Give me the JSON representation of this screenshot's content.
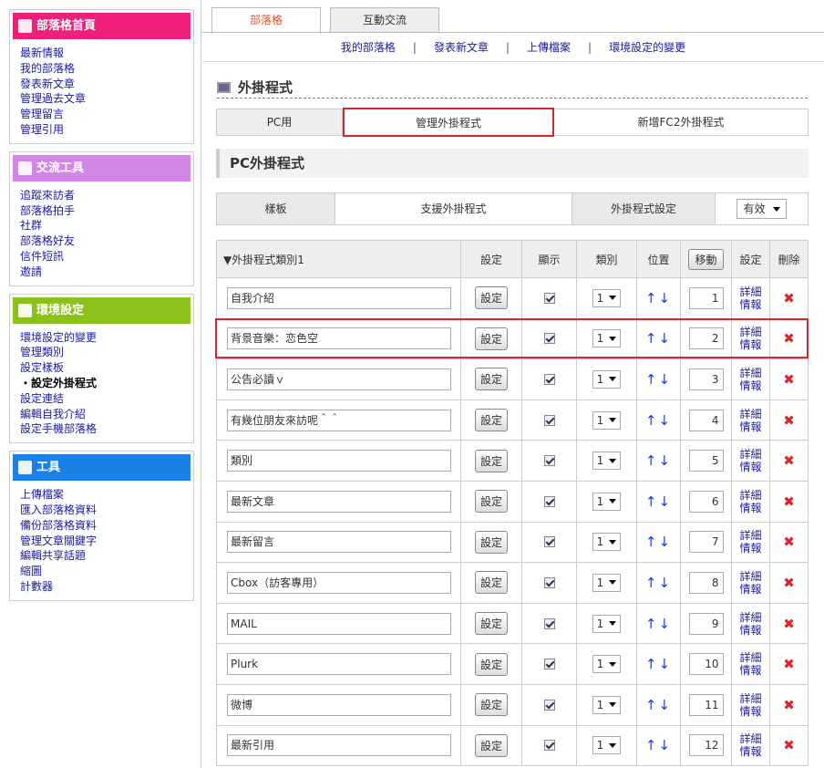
{
  "sidebar": {
    "home": {
      "title": "部落格首頁",
      "items": [
        "最新情報",
        "我的部落格",
        "發表新文章",
        "管理過去文章",
        "管理留言",
        "管理引用"
      ]
    },
    "tools": {
      "title": "交流工具",
      "items": [
        "追蹤來訪者",
        "部落格拍手",
        "社群",
        "部落格好友",
        "信件短訊",
        "邀請"
      ]
    },
    "env": {
      "title": "環境設定",
      "items": [
        "環境設定的變更",
        "管理類別",
        "設定樣板",
        "・設定外掛程式",
        "設定連結",
        "編輯自我介紹",
        "設定手機部落格"
      ]
    },
    "util": {
      "title": "工具",
      "items": [
        "上傳檔案",
        "匯入部落格資料",
        "備份部落格資料",
        "管理文章關鍵字",
        "編輯共享話題",
        "縮圖",
        "計數器"
      ]
    }
  },
  "top_tabs": [
    "部落格",
    "互動交流"
  ],
  "subnav": [
    "我的部落格",
    "發表新文章",
    "上傳檔案",
    "環境設定的變更"
  ],
  "page_title": "外掛程式",
  "plugin_tabs": [
    "PC用",
    "管理外掛程式",
    "新增FC2外掛程式"
  ],
  "section_title": "PC外掛程式",
  "settings": {
    "template_label": "樣板",
    "support_label": "支援外掛程式",
    "plugin_setting_label": "外掛程式設定",
    "status": "有效"
  },
  "table": {
    "headers": {
      "category": "▼外掛程式類別1",
      "set": "設定",
      "show": "顯示",
      "cat": "類別",
      "pos": "位置",
      "move": "移動",
      "setting": "設定",
      "delete": "刪除"
    },
    "set_button": "設定",
    "detail1": "詳細",
    "detail2": "情報",
    "delete_icon": "✖",
    "up_down": "↑↓",
    "rows": [
      {
        "name": "自我介紹",
        "cat": "1",
        "pos": "1"
      },
      {
        "name": "背景音樂：恋色空",
        "cat": "1",
        "pos": "2"
      },
      {
        "name": "公告必讀ｖ",
        "cat": "1",
        "pos": "3"
      },
      {
        "name": "有幾位朋友來訪呢＾＾",
        "cat": "1",
        "pos": "4"
      },
      {
        "name": "類別",
        "cat": "1",
        "pos": "5"
      },
      {
        "name": "最新文章",
        "cat": "1",
        "pos": "6"
      },
      {
        "name": "最新留言",
        "cat": "1",
        "pos": "7"
      },
      {
        "name": "Cbox（訪客專用）",
        "cat": "1",
        "pos": "8"
      },
      {
        "name": "MAIL",
        "cat": "1",
        "pos": "9"
      },
      {
        "name": "Plurk",
        "cat": "1",
        "pos": "10"
      },
      {
        "name": "微博",
        "cat": "1",
        "pos": "11"
      },
      {
        "name": "最新引用",
        "cat": "1",
        "pos": "12"
      }
    ]
  }
}
